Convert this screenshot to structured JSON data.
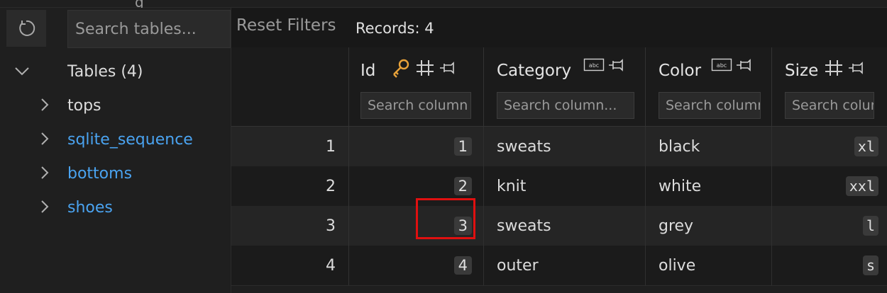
{
  "top_fragment": "g",
  "sidebar": {
    "search_placeholder": "Search tables...",
    "root": {
      "label": "Tables (4)"
    },
    "tables": [
      {
        "label": "tops",
        "style": "default"
      },
      {
        "label": "sqlite_sequence",
        "style": "link"
      },
      {
        "label": "bottoms",
        "style": "link"
      },
      {
        "label": "shoes",
        "style": "link"
      }
    ]
  },
  "toolbar": {
    "reset_label": "Reset Filters",
    "records_label": "Records: 4"
  },
  "columns": [
    {
      "title": "Id",
      "type": "number",
      "primary_key": true,
      "placeholder": "Search column"
    },
    {
      "title": "Category",
      "type": "text",
      "placeholder": "Search column..."
    },
    {
      "title": "Color",
      "type": "text",
      "placeholder": "Search column"
    },
    {
      "title": "Size",
      "type": "number",
      "placeholder": "Search column"
    }
  ],
  "rows": [
    {
      "n": "1",
      "id": "1",
      "category": "sweats",
      "color": "black",
      "size": "xl"
    },
    {
      "n": "2",
      "id": "2",
      "category": "knit",
      "color": "white",
      "size": "xxl"
    },
    {
      "n": "3",
      "id": "3",
      "category": "sweats",
      "color": "grey",
      "size": "l"
    },
    {
      "n": "4",
      "id": "4",
      "category": "outer",
      "color": "olive",
      "size": "s"
    }
  ],
  "highlight": {
    "row": 3,
    "column": "Color",
    "color": "#e01010"
  },
  "colors": {
    "link": "#4aa3f0",
    "key_icon": "#e8a23a",
    "background": "#181818"
  }
}
